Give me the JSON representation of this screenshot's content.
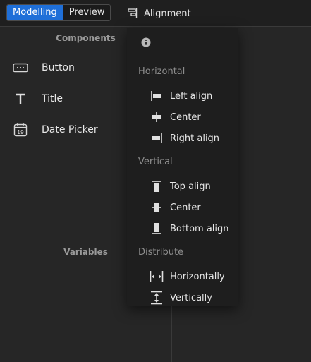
{
  "toolbar": {
    "modes": [
      {
        "label": "Modelling",
        "active": true
      },
      {
        "label": "Preview",
        "active": false
      }
    ],
    "alignment_label": "Alignment",
    "alignment_icon": "align-icon"
  },
  "components": {
    "header": "Components",
    "items": [
      {
        "label": "Button",
        "icon": "button-icon"
      },
      {
        "label": "Title",
        "icon": "title-icon"
      },
      {
        "label": "Date Picker",
        "icon": "calendar-icon",
        "icon_text": "19"
      }
    ]
  },
  "variables": {
    "header": "Variables"
  },
  "dropdown": {
    "info_icon": "info-icon",
    "groups": {
      "horizontal": "Horizontal",
      "vertical": "Vertical",
      "distribute": "Distribute"
    },
    "items": {
      "left_align": "Left align",
      "h_center": "Center",
      "right_align": "Right align",
      "top_align": "Top align",
      "v_center": "Center",
      "bottom_align": "Bottom align",
      "dist_h": "Horizontally",
      "dist_v": "Vertically"
    }
  },
  "colors": {
    "accent": "#1f6fd8",
    "background": "#262626",
    "dropdown": "#1e1e1e",
    "text": "#e6e6e6",
    "muted": "#8c8c8c"
  }
}
